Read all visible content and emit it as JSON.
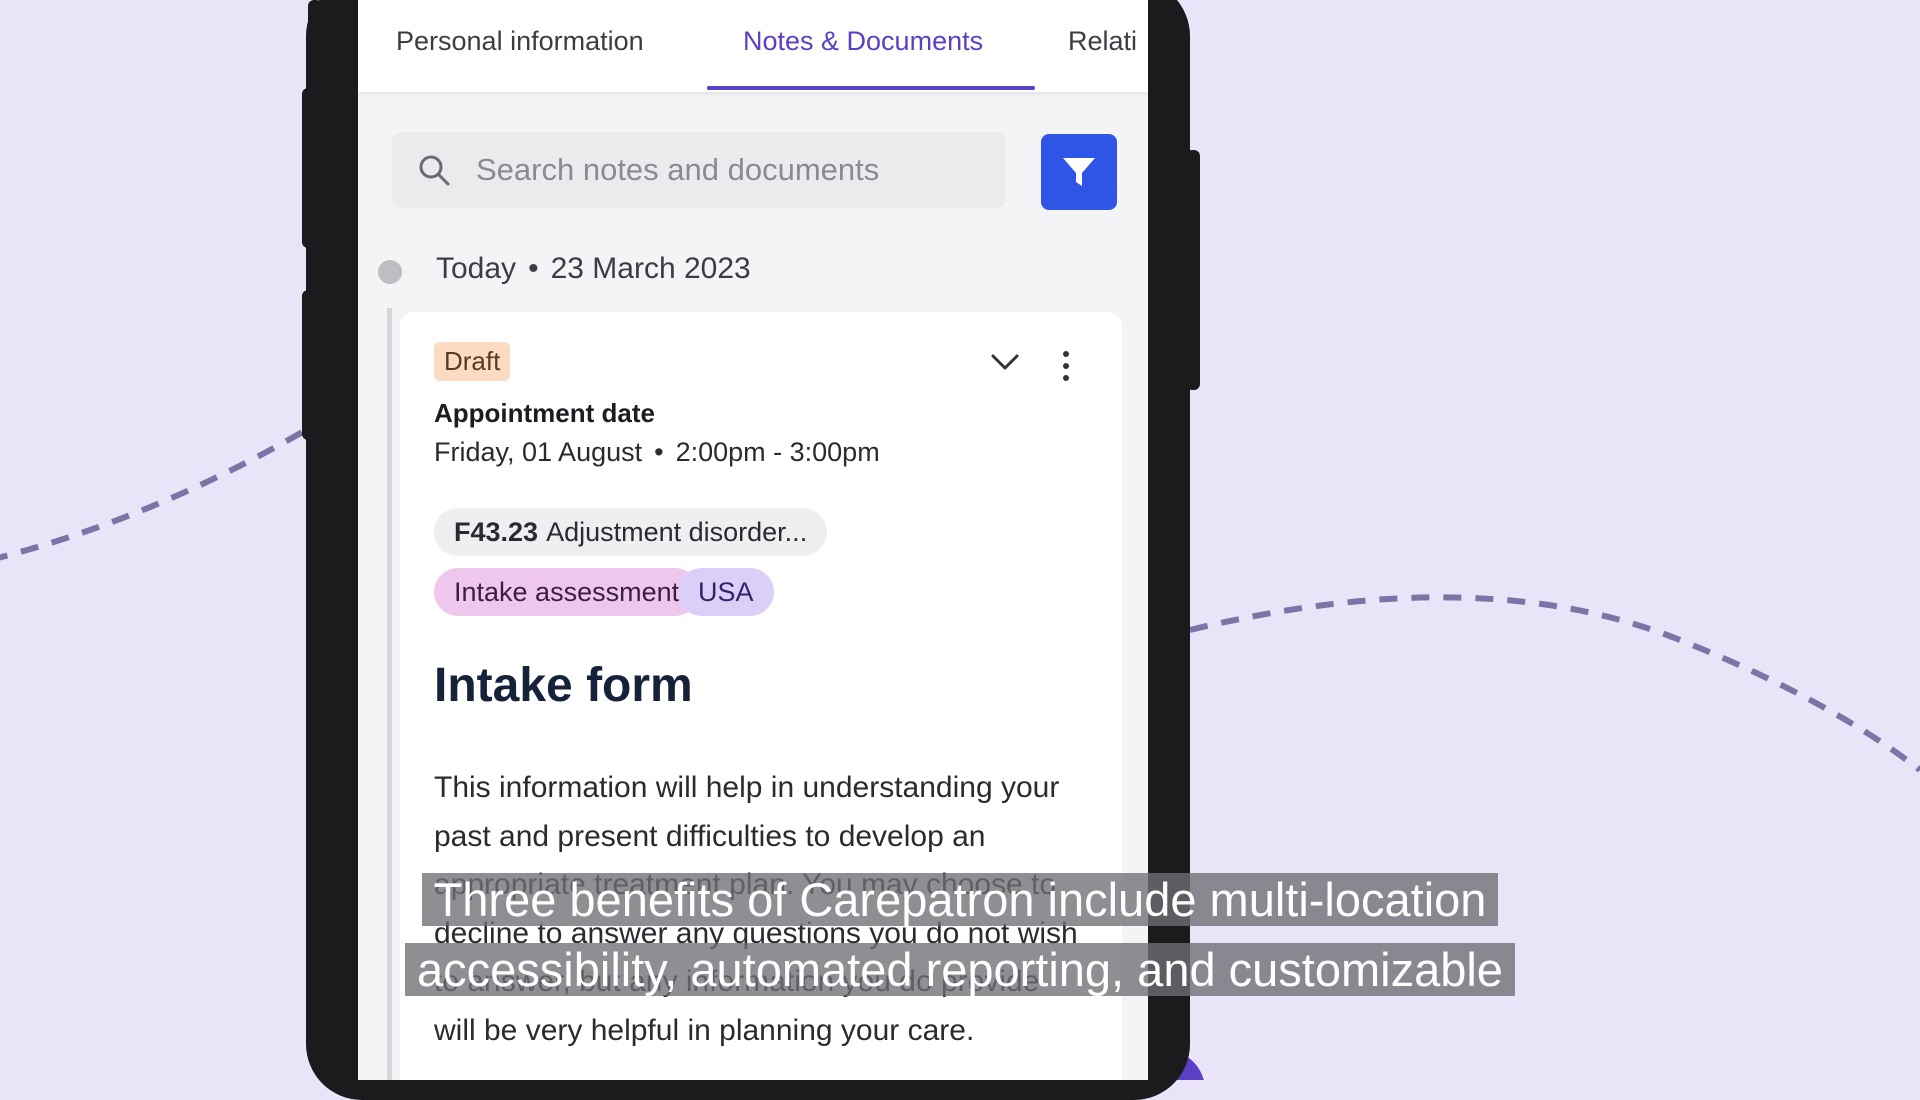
{
  "tabs": [
    {
      "label": "Personal information"
    },
    {
      "label": "Notes & Documents"
    },
    {
      "label": "Relati"
    }
  ],
  "search": {
    "placeholder": "Search notes and documents"
  },
  "timeline": {
    "day": "Today",
    "date": "23 March 2023"
  },
  "note": {
    "status": "Draft",
    "appointment_label": "Appointment date",
    "appointment_day": "Friday, 01 August",
    "appointment_time": "2:00pm - 3:00pm",
    "diagnosis_code": "F43.23",
    "diagnosis_name": "Adjustment disorder...",
    "tags": [
      "Intake assessment",
      "USA"
    ],
    "title": "Intake form",
    "body": "This information will help in understanding your past and present difficulties to develop an appropriate treatment plan. You may choose to decline to answer any questions you do not wish to answer, but any information you do provide will be very helpful in planning your care."
  },
  "caption": "Three benefits of Carepatron include multi-location accessibility, automated reporting, and customizable",
  "colors": {
    "background": "#e9e4f7",
    "accent": "#5b3fc4",
    "filter_button": "#2f55e6",
    "draft_badge": "#fbdcc2",
    "tag_intake": "#f0c7ec",
    "tag_usa": "#dccff7"
  },
  "icons": [
    "search-icon",
    "filter-icon",
    "chevron-down-icon",
    "more-vertical-icon"
  ]
}
